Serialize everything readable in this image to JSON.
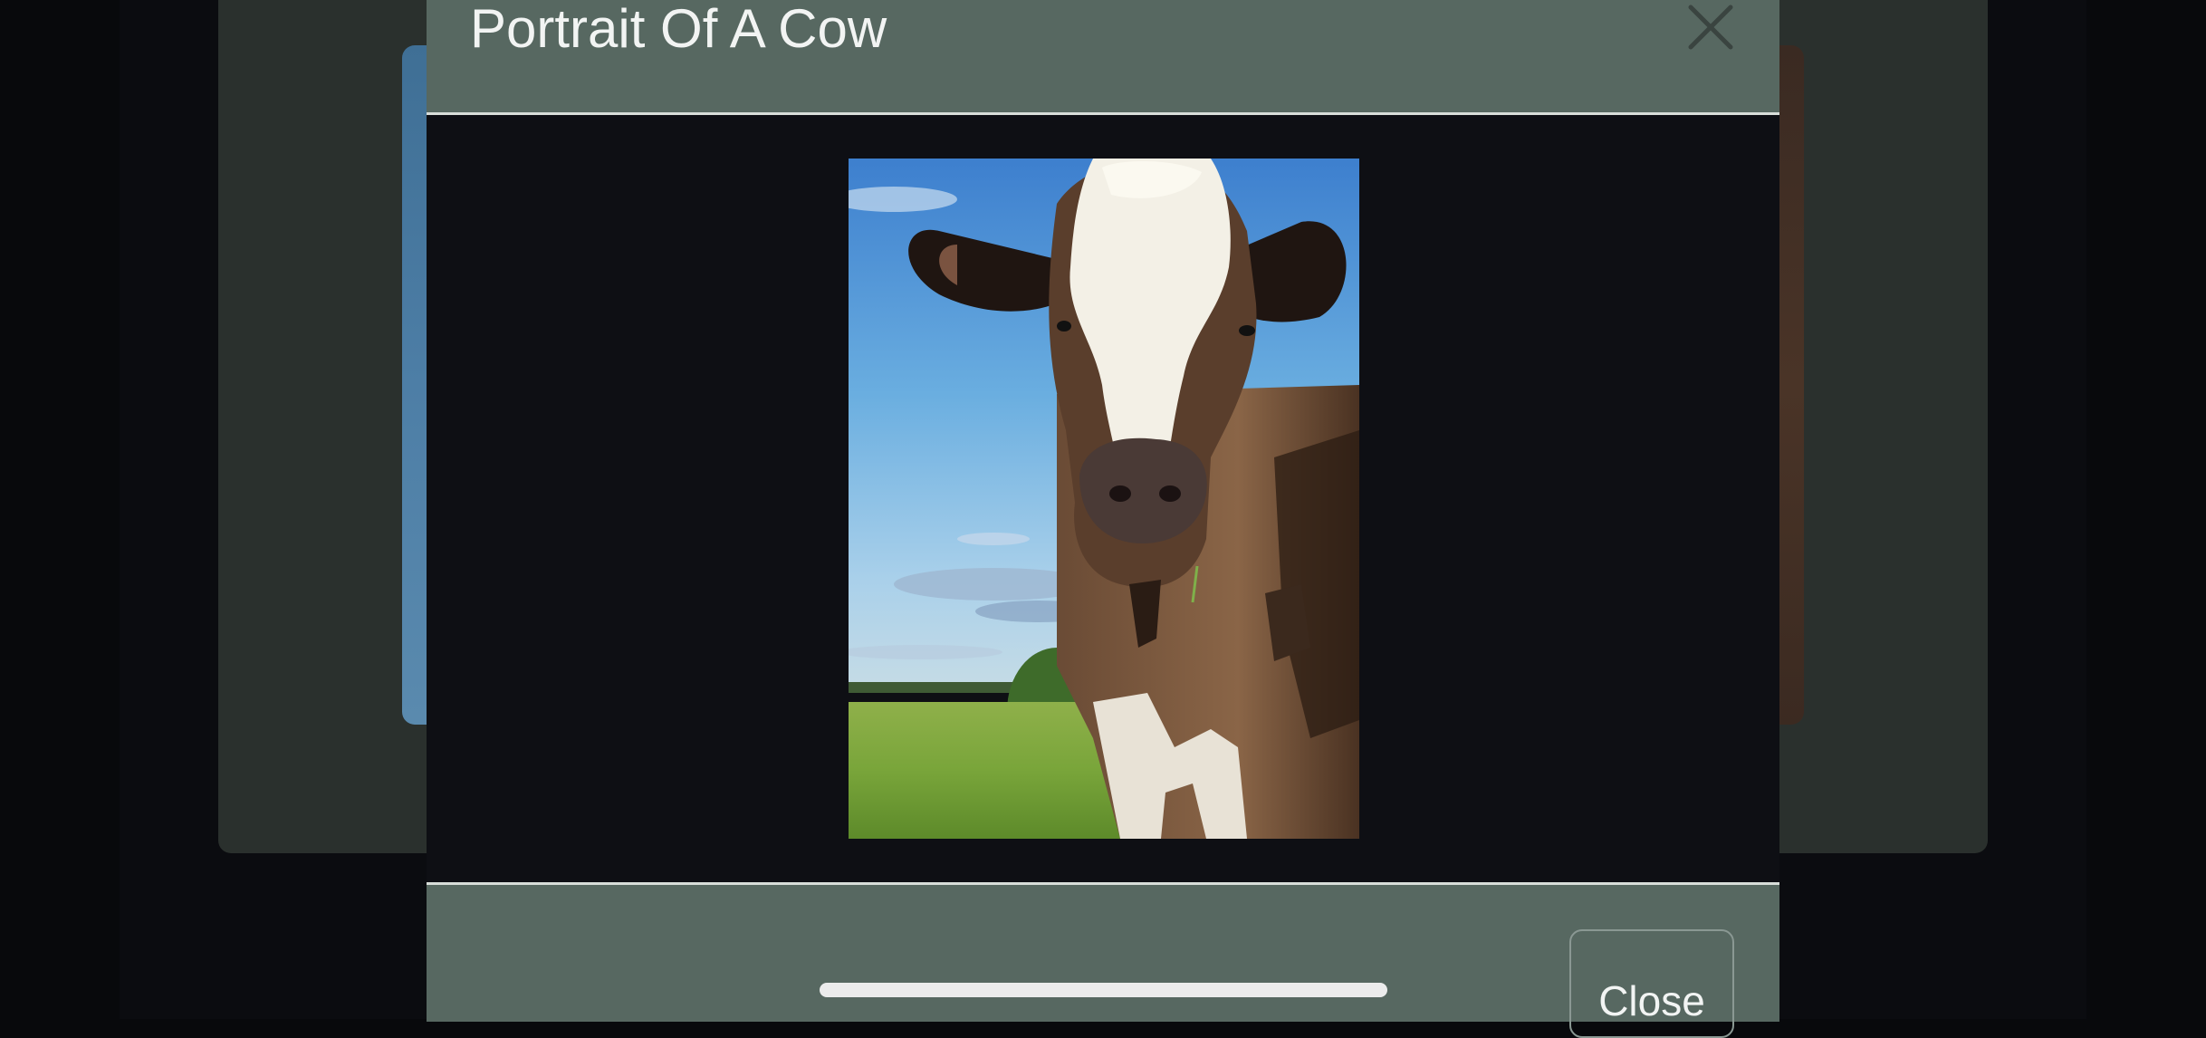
{
  "modal": {
    "title": "Portrait Of A Cow",
    "close_icon": "close-x-icon",
    "image": "cow-portrait-photo",
    "footer": {
      "close_label": "Close"
    }
  },
  "system": {
    "home_indicator": "home-indicator-bar"
  },
  "colors": {
    "modal_header": "#576861",
    "modal_body": "#0e0f14",
    "divider": "#d8ddd9",
    "title_text": "#f2f4f3"
  }
}
